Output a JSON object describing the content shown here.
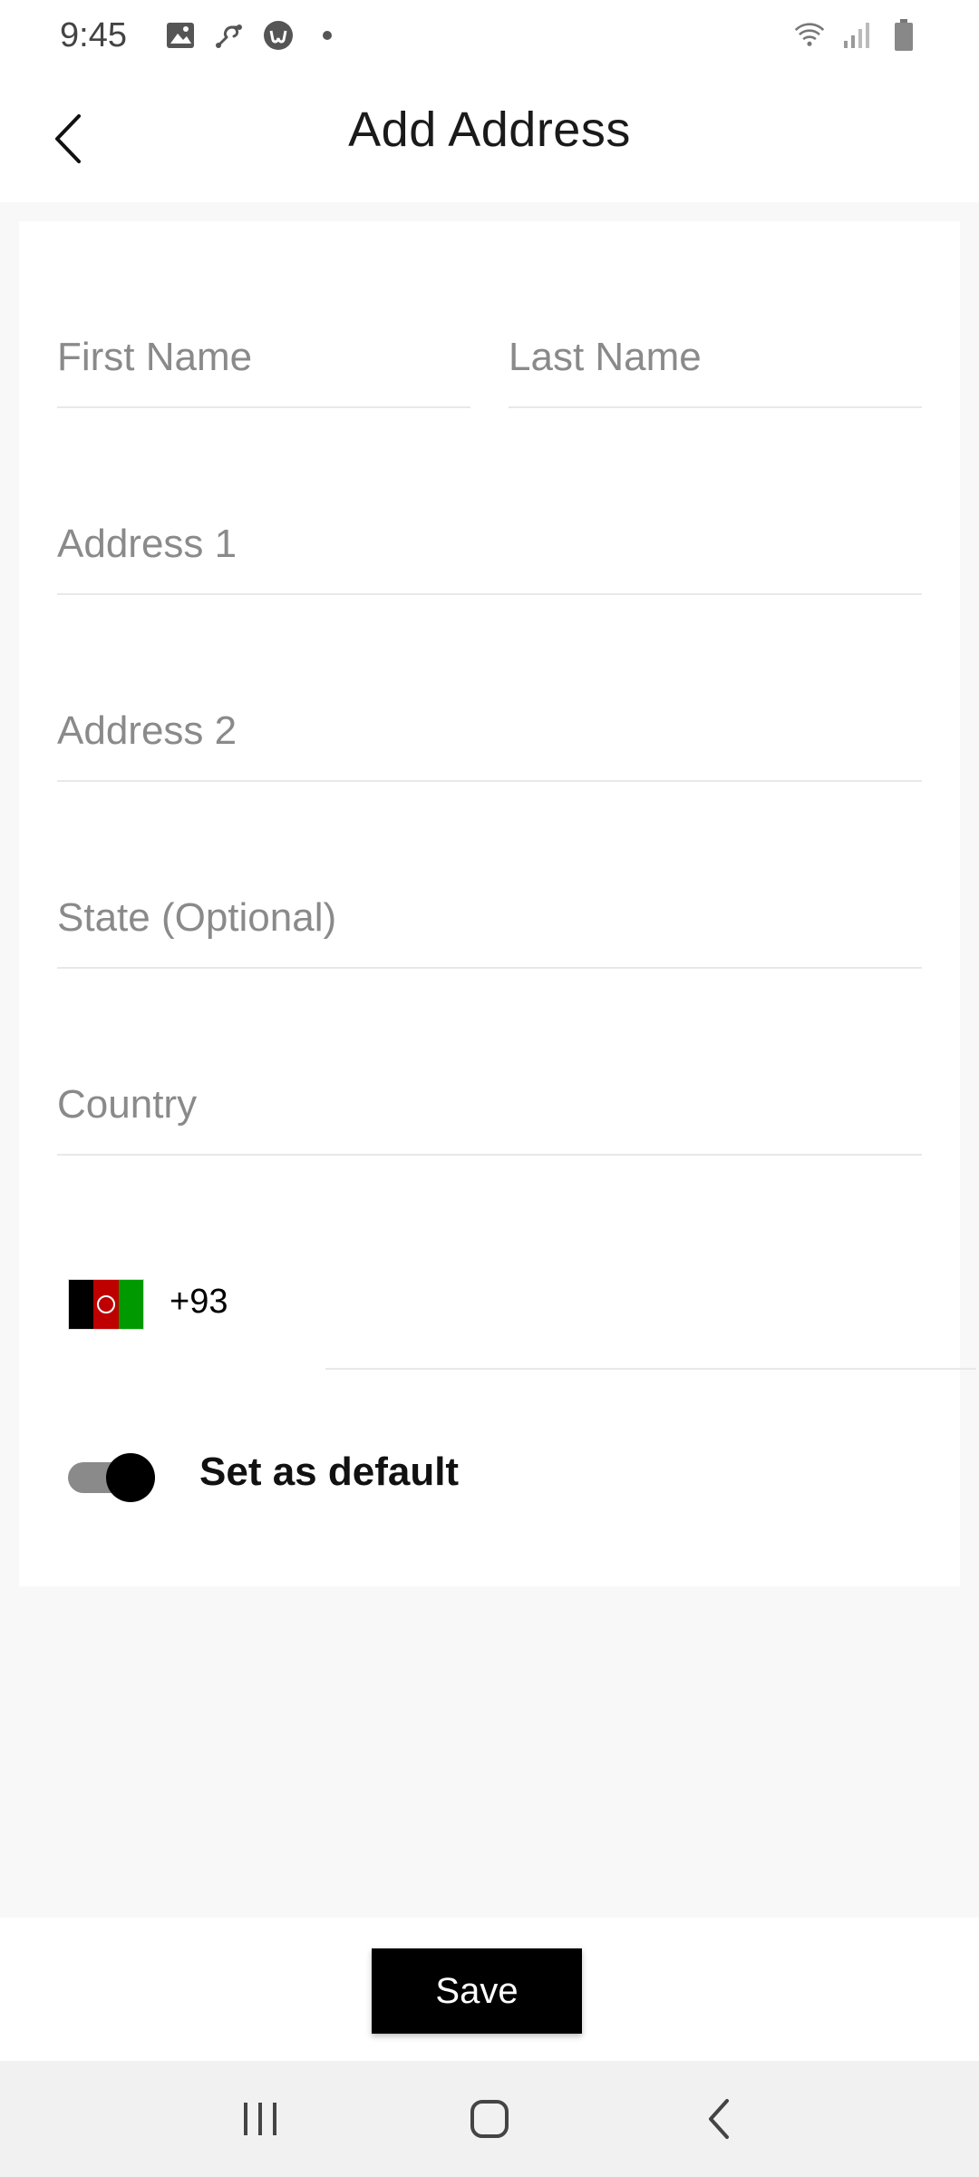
{
  "status_bar": {
    "time": "9:45",
    "left_icons": [
      "gallery-icon",
      "link-icon",
      "app-u-icon",
      "dot-icon"
    ],
    "right_icons": [
      "wifi-icon",
      "signal-icon",
      "battery-icon"
    ]
  },
  "header": {
    "title": "Add Address",
    "back_icon": "chevron-left-icon"
  },
  "form": {
    "first_name": {
      "placeholder": "First Name",
      "value": ""
    },
    "last_name": {
      "placeholder": "Last Name",
      "value": ""
    },
    "address1": {
      "placeholder": "Address 1",
      "value": ""
    },
    "address2": {
      "placeholder": "Address 2",
      "value": ""
    },
    "state": {
      "placeholder": "State (Optional)",
      "value": ""
    },
    "country": {
      "placeholder": "Country",
      "value": ""
    },
    "phone": {
      "country_flag": "afghanistan-flag-icon",
      "dial_code": "+93",
      "value": ""
    },
    "set_default": {
      "label": "Set as default",
      "enabled": true
    }
  },
  "actions": {
    "save_label": "Save"
  },
  "nav": {
    "items": [
      "recent-apps-icon",
      "home-icon",
      "back-icon"
    ]
  },
  "colors": {
    "background": "#f8f8f8",
    "card": "#ffffff",
    "button": "#000000",
    "placeholder": "#8a8a8a",
    "divider": "#e8e8e8"
  }
}
